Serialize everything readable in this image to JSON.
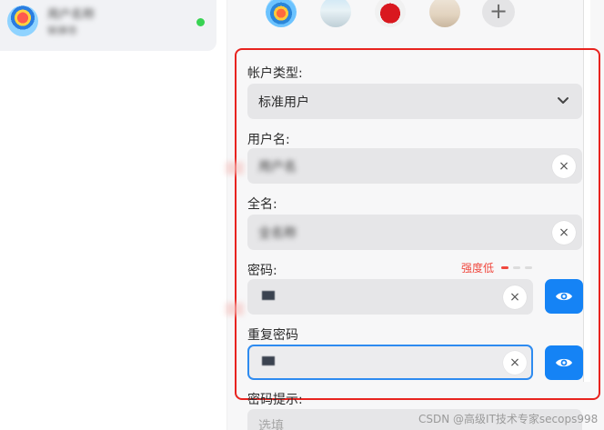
{
  "user_list": {
    "selected_user": {
      "name": "用户名称",
      "subtitle": "管理员",
      "online_color": "#39d353"
    }
  },
  "avatars": {
    "options": [
      "balloon",
      "beach",
      "heart",
      "room"
    ],
    "add_icon": "+"
  },
  "form": {
    "account_type": {
      "label": "帐户类型:",
      "value": "标准用户"
    },
    "username": {
      "label": "用户名:",
      "value": "用户名"
    },
    "fullname": {
      "label": "全名:",
      "value": "全名称"
    },
    "password": {
      "label": "密码:",
      "strength_label": "强度低"
    },
    "repeat_password": {
      "label": "重复密码"
    },
    "password_hint": {
      "label": "密码提示:",
      "placeholder": "选填"
    },
    "clear_icon": "×"
  },
  "colors": {
    "accent": "#1583f5",
    "highlight_frame": "#e8231f",
    "strength_low": "#f0483e"
  },
  "watermark": "CSDN @高级IT技术专家secops998"
}
